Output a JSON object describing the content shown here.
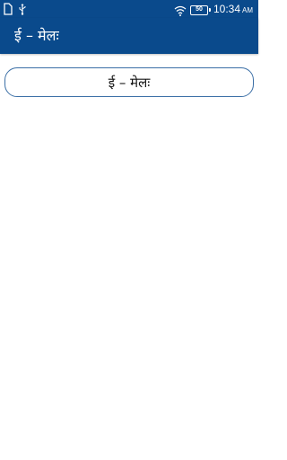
{
  "status_bar": {
    "battery_level": "50",
    "time": "10:34",
    "ampm": "AM",
    "icons": [
      "sim-icon",
      "usb-icon",
      "wifi-icon",
      "battery-icon"
    ]
  },
  "app_bar": {
    "title": "ई – मेलः"
  },
  "main": {
    "label_box_text": "ई – मेलः"
  },
  "colors": {
    "primary": "#0a4a8c",
    "box_border": "#3b6fa6",
    "background": "#ffffff"
  }
}
